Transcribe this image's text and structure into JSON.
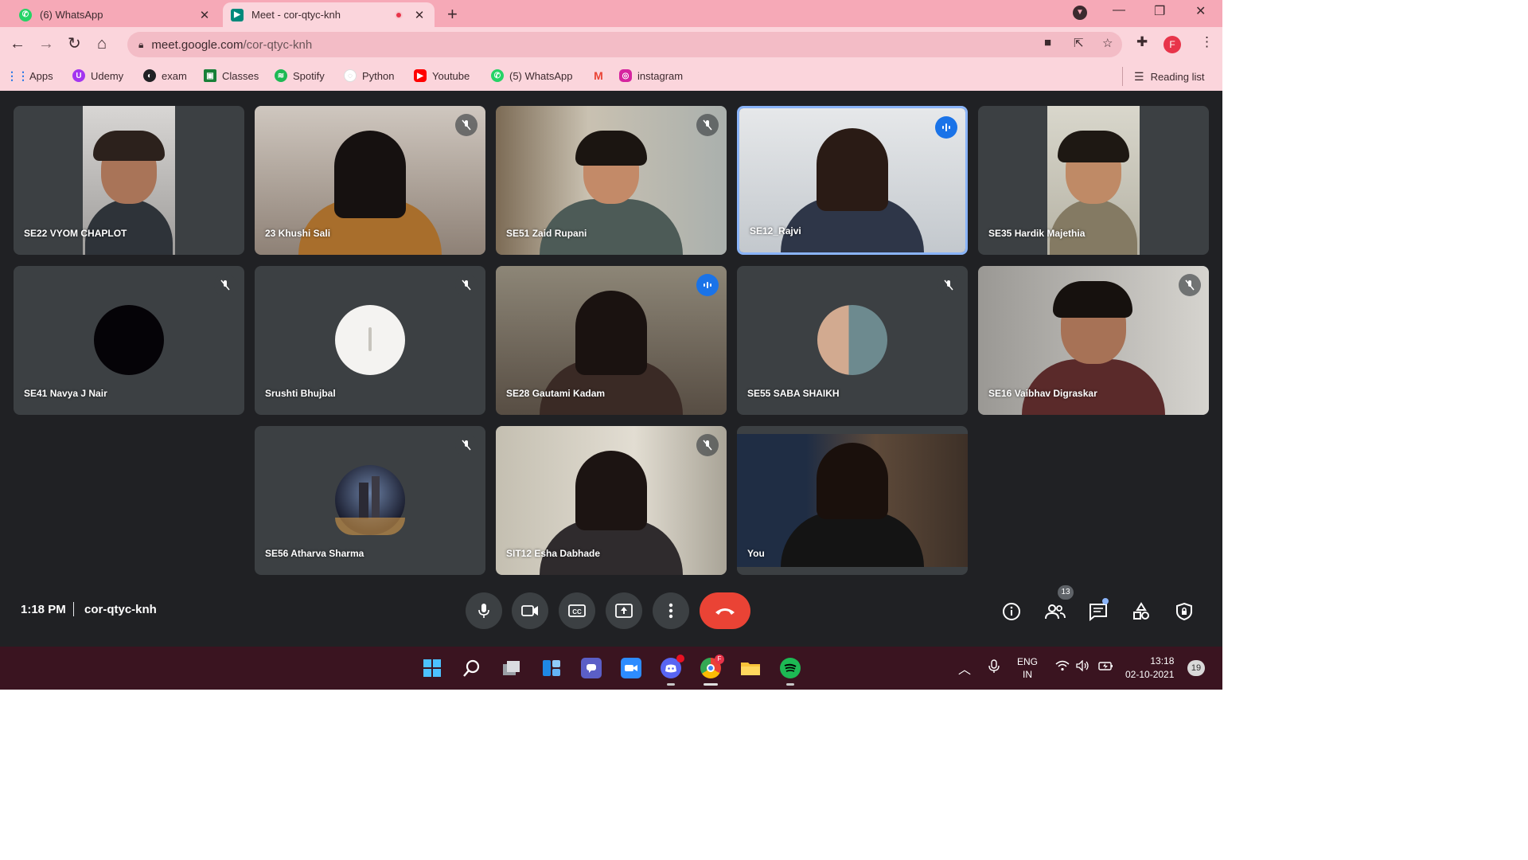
{
  "browser": {
    "tabs": [
      {
        "label": "(6) WhatsApp",
        "favicon": "whatsapp-icon"
      },
      {
        "label": "Meet - cor-qtyc-knh",
        "favicon": "google-meet-icon",
        "recording": true
      }
    ],
    "url_host": "meet.google.com",
    "url_path": "/cor-qtyc-knh",
    "profile_initial": "F",
    "bookmarks": [
      {
        "label": "Apps",
        "icon": "apps-grid-icon"
      },
      {
        "label": "Udemy",
        "icon": "udemy-icon"
      },
      {
        "label": "exam",
        "icon": "globe-icon"
      },
      {
        "label": "Classes",
        "icon": "classroom-icon"
      },
      {
        "label": "Spotify",
        "icon": "spotify-icon"
      },
      {
        "label": "Python",
        "icon": "python-icon"
      },
      {
        "label": "Youtube",
        "icon": "youtube-icon"
      },
      {
        "label": "(5) WhatsApp",
        "icon": "whatsapp-icon"
      },
      {
        "label": "",
        "icon": "gmail-icon"
      },
      {
        "label": "instagram",
        "icon": "instagram-icon"
      }
    ],
    "reading_list": "Reading list"
  },
  "meet": {
    "participants": [
      {
        "name": "SE22 VYOM CHAPLOT",
        "muted": false,
        "speaking": false
      },
      {
        "name": "23 Khushi Sali",
        "muted": true,
        "speaking": false
      },
      {
        "name": "SE51 Zaid Rupani",
        "muted": true,
        "speaking": false
      },
      {
        "name": "SE12_Rajvi",
        "muted": false,
        "speaking": true
      },
      {
        "name": "SE35 Hardik Majethia",
        "muted": false,
        "speaking": false
      },
      {
        "name": "SE41 Navya J Nair",
        "muted": true,
        "speaking": false
      },
      {
        "name": "Srushti Bhujbal",
        "muted": true,
        "speaking": false
      },
      {
        "name": "SE28 Gautami Kadam",
        "muted": false,
        "speaking": true
      },
      {
        "name": "SE55 SABA SHAIKH",
        "muted": true,
        "speaking": false
      },
      {
        "name": "SE16 Vaibhav Digraskar",
        "muted": true,
        "speaking": false
      },
      {
        "name": "SE56 Atharva Sharma",
        "muted": true,
        "speaking": false
      },
      {
        "name": "SIT12 Esha Dabhade",
        "muted": true,
        "speaking": false
      },
      {
        "name": "You",
        "muted": false,
        "speaking": false
      }
    ],
    "time": "1:18 PM",
    "meeting_code": "cor-qtyc-knh",
    "people_count": "13"
  },
  "taskbar": {
    "language": "ENG",
    "region": "IN",
    "time": "13:18",
    "date": "02-10-2021",
    "notification_count": "19"
  },
  "colors": {
    "browser_frame": "#f6a9b7",
    "meet_background": "#202124",
    "tile": "#3c4043",
    "end_call": "#ea4335",
    "speaking": "#1a73e8",
    "taskbar": "#3a1420"
  }
}
